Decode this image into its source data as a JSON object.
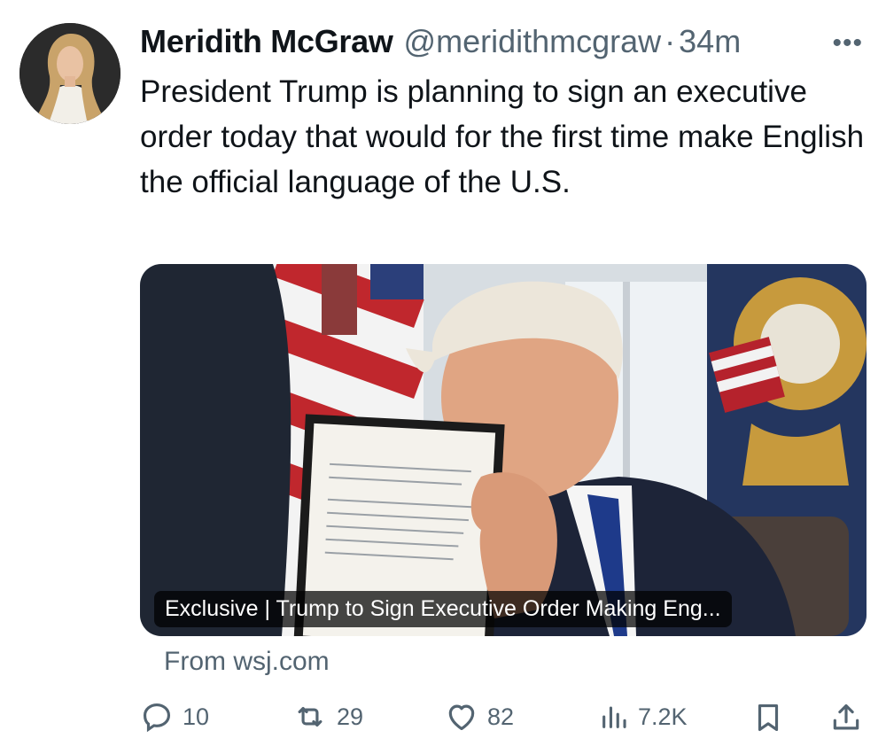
{
  "tweet": {
    "author_name": "Meridith McGraw",
    "handle": "@meridithmcgraw",
    "separator": "·",
    "time": "34m",
    "text": "President Trump is planning to sign an executive order today that would for the first time make English the official language of the U.S.",
    "more_icon": "more-horizontal-icon"
  },
  "card": {
    "title": "Exclusive | Trump to Sign Executive Order Making Eng...",
    "source": "From wsj.com"
  },
  "actions": {
    "replies": "10",
    "retweets": "29",
    "likes": "82",
    "views": "7.2K"
  },
  "colors": {
    "text": "#0f1419",
    "secondary": "#536471",
    "background": "#ffffff"
  }
}
